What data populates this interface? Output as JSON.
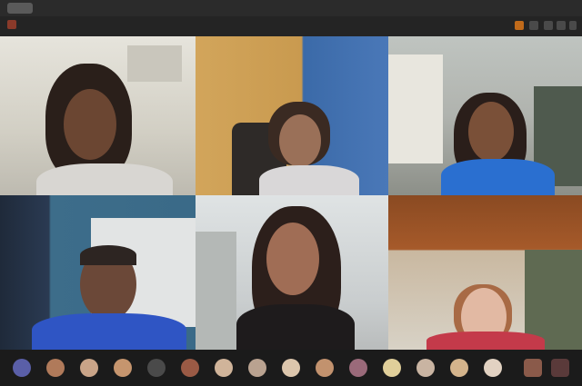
{
  "window": {
    "title": "",
    "app_badge_icon": "app-badge-icon"
  },
  "toolbar": {
    "left_icon": "record-icon",
    "controls": [
      "share-icon",
      "people-icon",
      "chat-icon",
      "more-icon",
      "close-icon"
    ],
    "accent_color": "#c06a1a"
  },
  "participants": [
    {
      "name": "",
      "position": "top-left"
    },
    {
      "name": "",
      "position": "top-center"
    },
    {
      "name": "",
      "position": "top-right"
    },
    {
      "name": "",
      "position": "bottom-left"
    },
    {
      "name": "",
      "position": "bottom-center"
    },
    {
      "name": "",
      "position": "bottom-right"
    }
  ],
  "thumbnail_strip": {
    "count": 17
  }
}
